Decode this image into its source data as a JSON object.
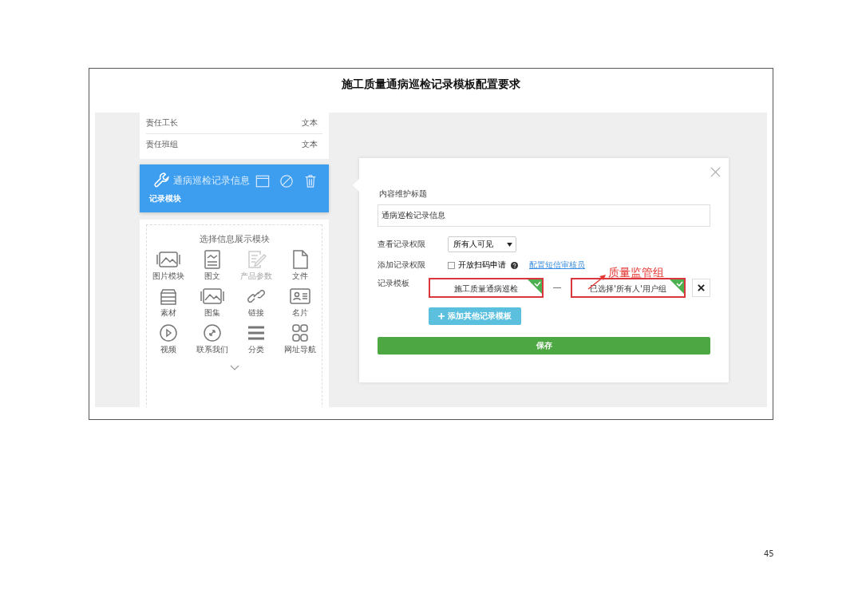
{
  "document": {
    "title": "施工质量通病巡检记录模板配置要求",
    "page_number": "45"
  },
  "field_list": [
    {
      "name": "责任工长",
      "type": "文本"
    },
    {
      "name": "责任班组",
      "type": "文本"
    }
  ],
  "module_bar": {
    "faded_title": "通病巡检记录信息",
    "label": "记录模块"
  },
  "module_picker": {
    "title": "选择信息展示模块",
    "items": [
      {
        "label": "图片模块",
        "kind": "image",
        "disabled": false
      },
      {
        "label": "图文",
        "kind": "article",
        "disabled": false
      },
      {
        "label": "产品参数",
        "kind": "edit",
        "disabled": true
      },
      {
        "label": "文件",
        "kind": "file",
        "disabled": false
      },
      {
        "label": "素材",
        "kind": "stack",
        "disabled": false
      },
      {
        "label": "图集",
        "kind": "image",
        "disabled": false
      },
      {
        "label": "链接",
        "kind": "link",
        "disabled": false
      },
      {
        "label": "名片",
        "kind": "card",
        "disabled": false
      },
      {
        "label": "视频",
        "kind": "video",
        "disabled": false
      },
      {
        "label": "联系我们",
        "kind": "compass",
        "disabled": false
      },
      {
        "label": "分类",
        "kind": "list",
        "disabled": false
      },
      {
        "label": "网址导航",
        "kind": "grid",
        "disabled": false
      }
    ]
  },
  "dialog": {
    "title_label": "内容维护标题",
    "title_value": "通病巡检记录信息",
    "view_label": "查看记录权限",
    "view_value": "所有人可见",
    "add_label": "添加记录权限",
    "scan_checkbox": {
      "label": "开放扫码申请",
      "checked": false
    },
    "link": "配置短信审核员",
    "template_label": "记录模板",
    "templates": [
      {
        "template": "施工质量通病巡检",
        "group": "已选择'所有人'用户组"
      }
    ],
    "add_button": "添加其他记录模板",
    "save_button": "保存"
  },
  "annotation": "质量监管组"
}
